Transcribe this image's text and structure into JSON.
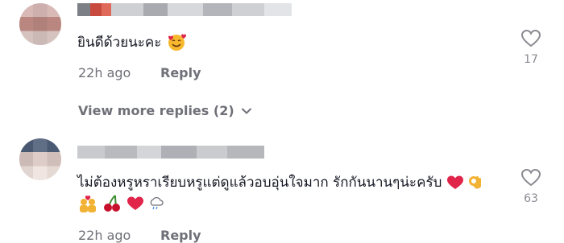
{
  "comments": [
    {
      "text": "ยินดีด้วยนะคะ",
      "emoji": "smiling-face-with-hearts",
      "time": "22h ago",
      "reply_label": "Reply",
      "likes": "17"
    },
    {
      "text": "ไม่ต้องหรูหราเรียบหรูแต่ดูแล้วอบอุ่นใจมาก รักกันนานๆน่ะครับ",
      "emojis": [
        "red-heart",
        "ok-hand",
        "couple-with-heart",
        "cherries",
        "red-heart",
        "cloud-rain"
      ],
      "time": "22h ago",
      "reply_label": "Reply",
      "likes": "63"
    }
  ],
  "view_more": {
    "label": "View more replies (2)"
  },
  "colors": {
    "text": "#161823",
    "muted": "#6f7078",
    "background": "#ffffff",
    "heart": "#e0244a"
  }
}
